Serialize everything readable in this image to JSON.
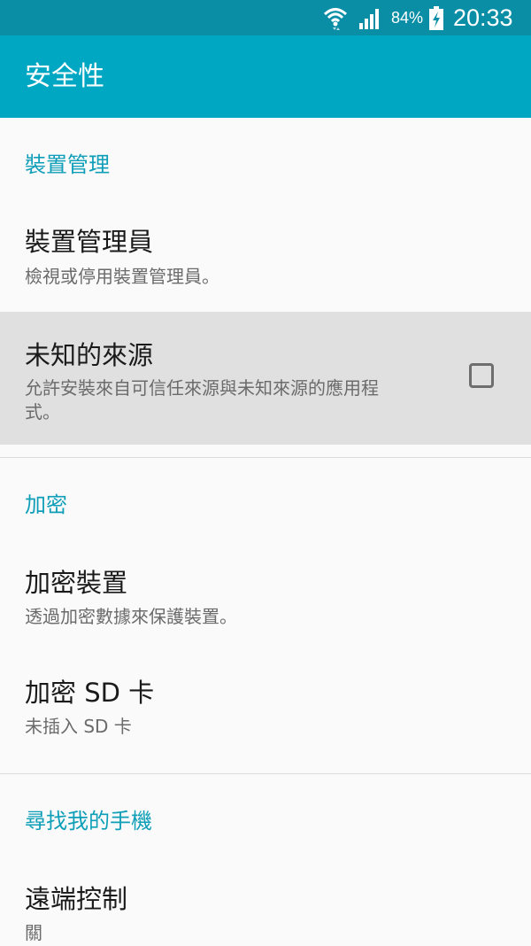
{
  "status_bar": {
    "battery_percent": "84%",
    "time": "20:33",
    "icons": [
      "wifi-icon",
      "signal-icon",
      "battery-charging-icon"
    ]
  },
  "app_bar": {
    "title": "安全性"
  },
  "sections": {
    "device_admin": {
      "header": "裝置管理",
      "items": [
        {
          "title": "裝置管理員",
          "subtitle": "檢視或停用裝置管理員。"
        },
        {
          "title": "未知的來源",
          "subtitle_line1": "允許安裝來自可信任來源與未知來源的應用程",
          "subtitle_line2": "式。",
          "checked": false
        }
      ]
    },
    "encryption": {
      "header": "加密",
      "items": [
        {
          "title": "加密裝置",
          "subtitle": "透過加密數據來保護裝置。"
        },
        {
          "title": "加密 SD 卡",
          "subtitle": "未插入 SD 卡"
        }
      ]
    },
    "find_my_mobile": {
      "header": "尋找我的手機",
      "items": [
        {
          "title": "遠端控制",
          "subtitle": "關"
        }
      ]
    }
  },
  "colors": {
    "status_bar": "#0a8ea6",
    "app_bar": "#00a7c3",
    "section_header": "#0f9eb8",
    "highlight": "#e0e0e0",
    "background": "#fafafa"
  }
}
